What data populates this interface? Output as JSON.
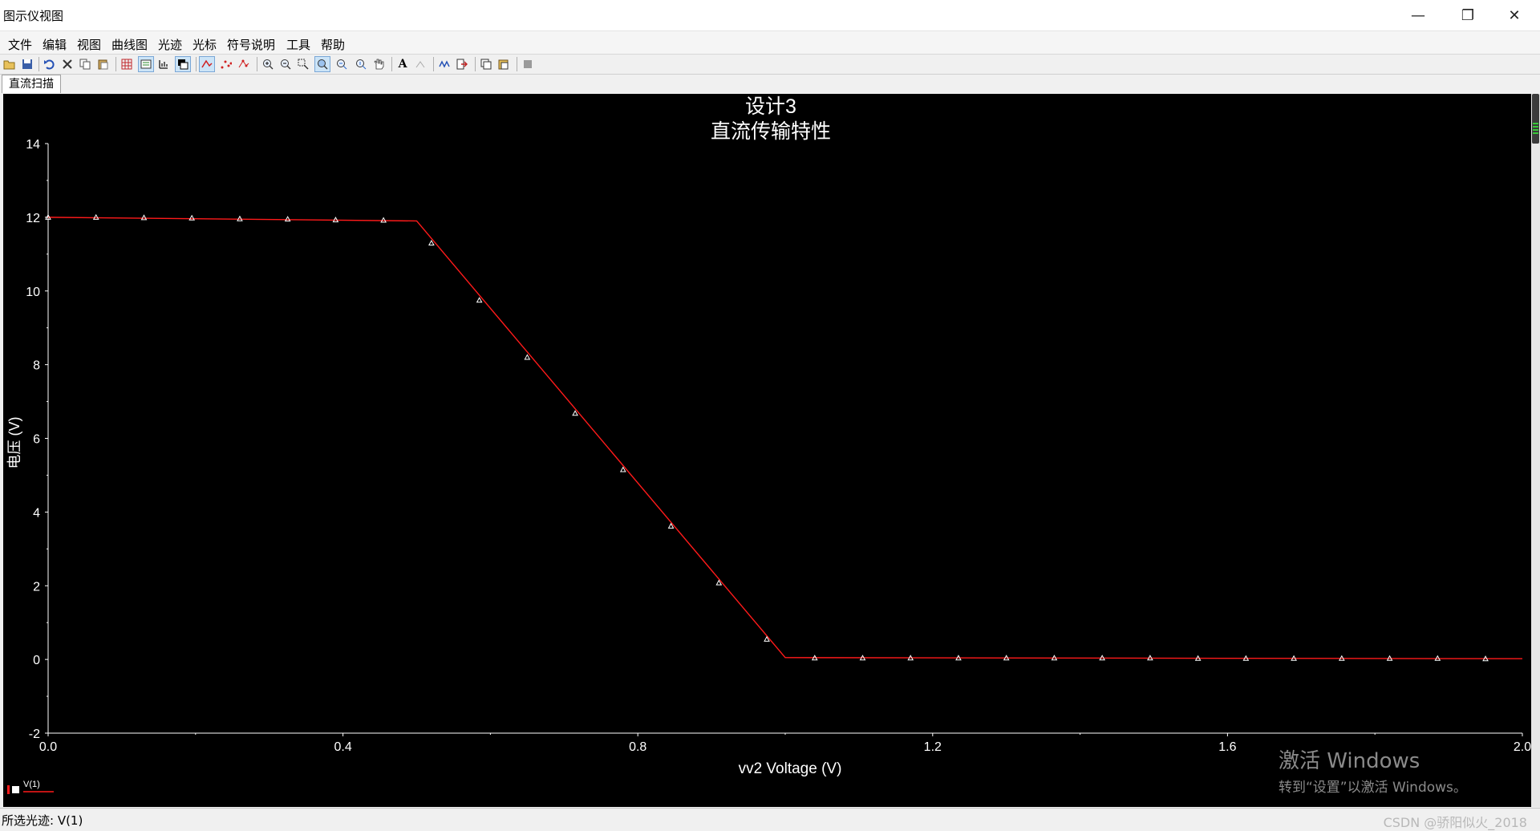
{
  "window": {
    "title": "图示仪视图",
    "minimize_glyph": "—",
    "restore_glyph": "❐",
    "close_glyph": "✕"
  },
  "menu": [
    "文件",
    "编辑",
    "视图",
    "曲线图",
    "光迹",
    "光标",
    "符号说明",
    "工具",
    "帮助"
  ],
  "toolbar_icons": [
    "open-icon",
    "save-icon",
    "undo-icon",
    "cut-icon",
    "copy-icon",
    "paste-icon",
    "grid-icon",
    "legend-icon",
    "select-mark-icon",
    "reverse-colors-icon",
    "line-icon",
    "dots-icon",
    "line-dots-icon",
    "zoom-in-icon",
    "zoom-out-icon",
    "zoom-area-icon",
    "zoom-full-icon",
    "zoom-x-icon",
    "zoom-y-icon",
    "pan-icon",
    "text-icon",
    "label-icon",
    "trace-icon",
    "export-icon",
    "copy-graph-icon",
    "paste-graph-icon",
    "stop-icon"
  ],
  "tab": {
    "label": "直流扫描"
  },
  "legend": {
    "label": "V(1)"
  },
  "status": {
    "text": "所选光迹: V(1)",
    "csdn_watermark": "CSDN @骄阳似火_2018"
  },
  "activation_watermark": {
    "line1": "激活 Windows",
    "line2": "转到“设置”以激活 Windows。"
  },
  "colors": {
    "plot_bg": "#000000",
    "trace": "#ff1a1a",
    "axis": "#ffffff",
    "text": "#ffffff"
  },
  "chart_data": {
    "type": "line",
    "title": "设计3",
    "subtitle": "直流传输特性",
    "xlabel": "vv2 Voltage (V)",
    "ylabel": "电压 (V)",
    "xlim": [
      0.0,
      2.0
    ],
    "ylim": [
      -2,
      14
    ],
    "x_ticks": [
      0.0,
      0.4,
      0.8,
      1.2,
      1.6,
      2.0
    ],
    "x_tick_labels": [
      "0.0",
      "0.4",
      "0.8",
      "1.2",
      "1.6",
      "2.0"
    ],
    "y_ticks": [
      -2,
      0,
      2,
      4,
      6,
      8,
      10,
      12,
      14
    ],
    "y_tick_labels": [
      "-2",
      "0",
      "2",
      "4",
      "6",
      "8",
      "10",
      "12",
      "14"
    ],
    "grid": false,
    "series": [
      {
        "name": "V(1)",
        "marker": "triangle",
        "line_x": [
          0.0,
          0.5,
          1.0,
          2.0
        ],
        "line_y": [
          12.0,
          11.9,
          0.05,
          0.02
        ],
        "points": [
          [
            0.0,
            12.0
          ],
          [
            0.065,
            12.0
          ],
          [
            0.13,
            11.99
          ],
          [
            0.195,
            11.98
          ],
          [
            0.26,
            11.96
          ],
          [
            0.325,
            11.95
          ],
          [
            0.39,
            11.93
          ],
          [
            0.455,
            11.92
          ],
          [
            0.52,
            11.3
          ],
          [
            0.585,
            9.75
          ],
          [
            0.65,
            8.2
          ],
          [
            0.715,
            6.68
          ],
          [
            0.78,
            5.15
          ],
          [
            0.845,
            3.62
          ],
          [
            0.91,
            2.08
          ],
          [
            0.975,
            0.55
          ],
          [
            1.04,
            0.04
          ],
          [
            1.105,
            0.04
          ],
          [
            1.17,
            0.04
          ],
          [
            1.235,
            0.04
          ],
          [
            1.3,
            0.04
          ],
          [
            1.365,
            0.04
          ],
          [
            1.43,
            0.04
          ],
          [
            1.495,
            0.04
          ],
          [
            1.56,
            0.03
          ],
          [
            1.625,
            0.03
          ],
          [
            1.69,
            0.03
          ],
          [
            1.755,
            0.03
          ],
          [
            1.82,
            0.03
          ],
          [
            1.885,
            0.03
          ],
          [
            1.95,
            0.02
          ]
        ]
      }
    ]
  }
}
